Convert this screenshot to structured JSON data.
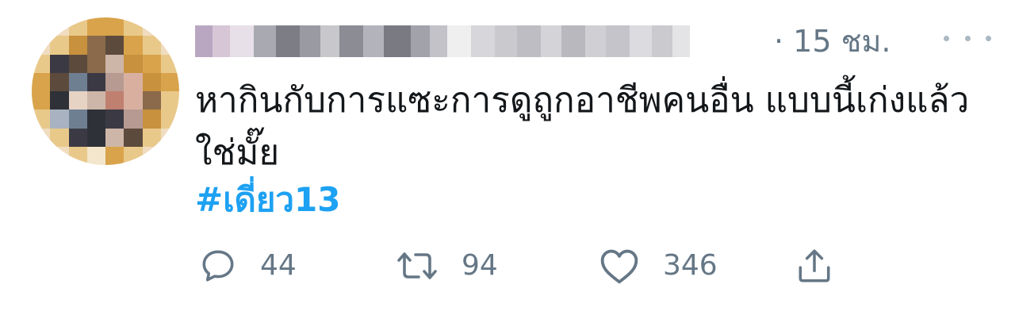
{
  "tweet": {
    "time": "· 15 ชม.",
    "text": "หากินกับการแซะการดูถูกอาชีพคนอื่น แบบนี้เก่งแล้วใช่มั๊ย",
    "hashtag": "#เดี่ยว13"
  },
  "actions": {
    "reply_count": "44",
    "retweet_count": "94",
    "like_count": "346"
  },
  "icons": {
    "reply": "reply-icon",
    "retweet": "retweet-icon",
    "like": "heart-icon",
    "share": "share-icon",
    "more": "more-icon"
  },
  "colors": {
    "hashtag": "#1da1f2",
    "secondary_text": "#657786",
    "text": "#14171a"
  }
}
